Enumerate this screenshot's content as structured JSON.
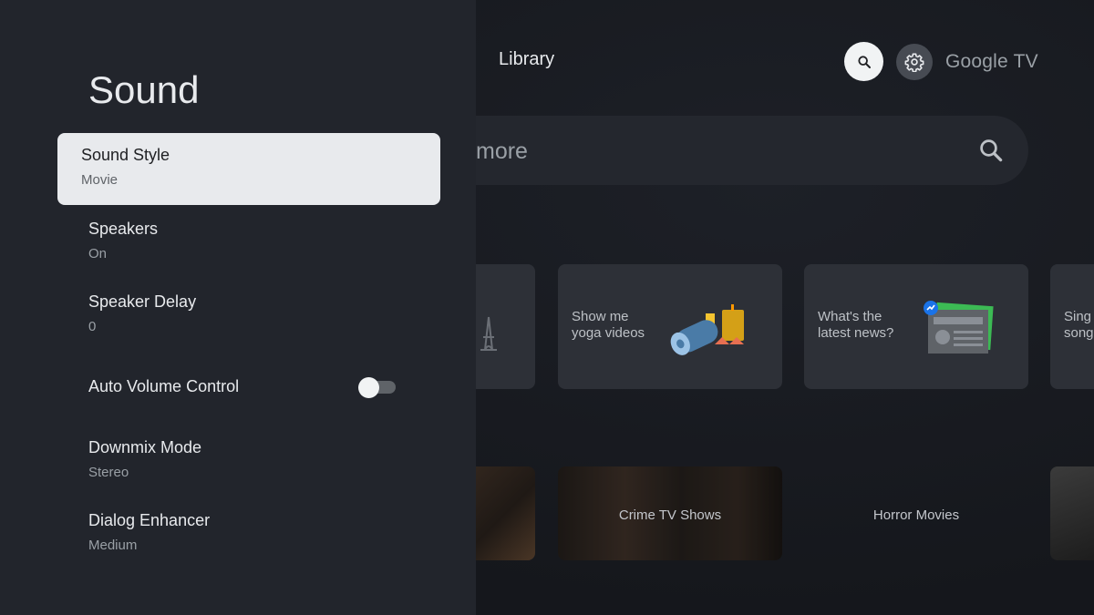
{
  "home": {
    "nav_library": "Library",
    "brand": "Google TV",
    "search_placeholder_visible": "more",
    "cards": [
      {
        "text": "Show me\nyoga videos"
      },
      {
        "text": "What's the\nlatest news?"
      },
      {
        "text": "Sing\nsong"
      }
    ],
    "tiles": [
      {
        "label": "Crime TV Shows"
      },
      {
        "label": "Horror Movies"
      }
    ],
    "colors": {
      "background": "#16181d",
      "search_bar": "#24272e",
      "card": "#2d3037"
    }
  },
  "settings_panel": {
    "title": "Sound",
    "items": [
      {
        "label": "Sound Style",
        "value": "Movie",
        "selected": true
      },
      {
        "label": "Speakers",
        "value": "On"
      },
      {
        "label": "Speaker Delay",
        "value": "0"
      },
      {
        "label": "Auto Volume Control",
        "toggle": false
      },
      {
        "label": "Downmix Mode",
        "value": "Stereo"
      },
      {
        "label": "Dialog Enhancer",
        "value": "Medium"
      }
    ],
    "colors": {
      "panel": "#22252c",
      "selected_item": "#e8eaed"
    }
  },
  "icons": {
    "nav_search": "search-icon",
    "nav_settings": "gear-icon",
    "search_bar": "search-icon"
  }
}
